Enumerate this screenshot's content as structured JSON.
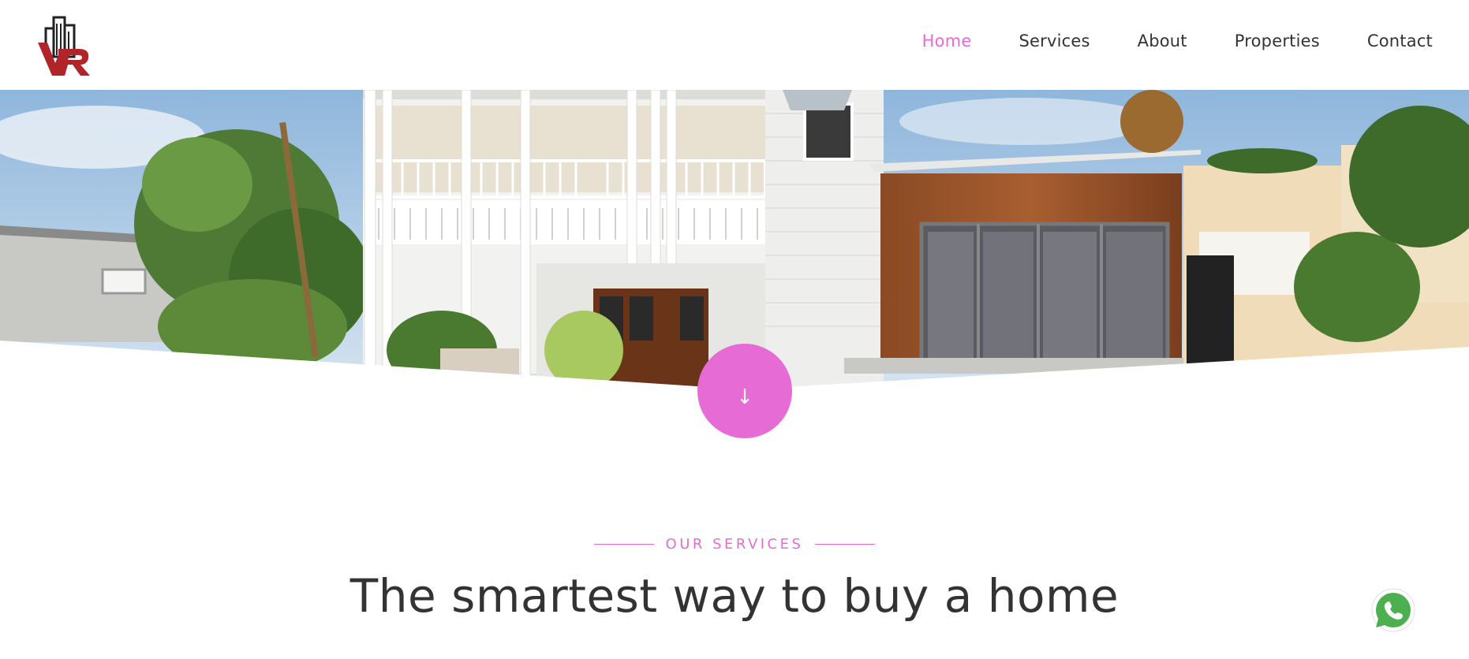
{
  "colors": {
    "accent": "#e76bd4",
    "text": "#333333",
    "logo_red": "#b0242a",
    "whatsapp": "#4caf50"
  },
  "nav": {
    "items": [
      {
        "label": "Home",
        "active": true
      },
      {
        "label": "Services",
        "active": false
      },
      {
        "label": "About",
        "active": false
      },
      {
        "label": "Properties",
        "active": false
      },
      {
        "label": "Contact",
        "active": false
      }
    ]
  },
  "hero": {
    "scroll_icon": "arrow-down-icon",
    "scroll_glyph": "↓"
  },
  "services": {
    "eyebrow": "OUR SERVICES",
    "headline": "The smartest way to buy a home"
  },
  "floating": {
    "icon": "whatsapp-icon"
  }
}
